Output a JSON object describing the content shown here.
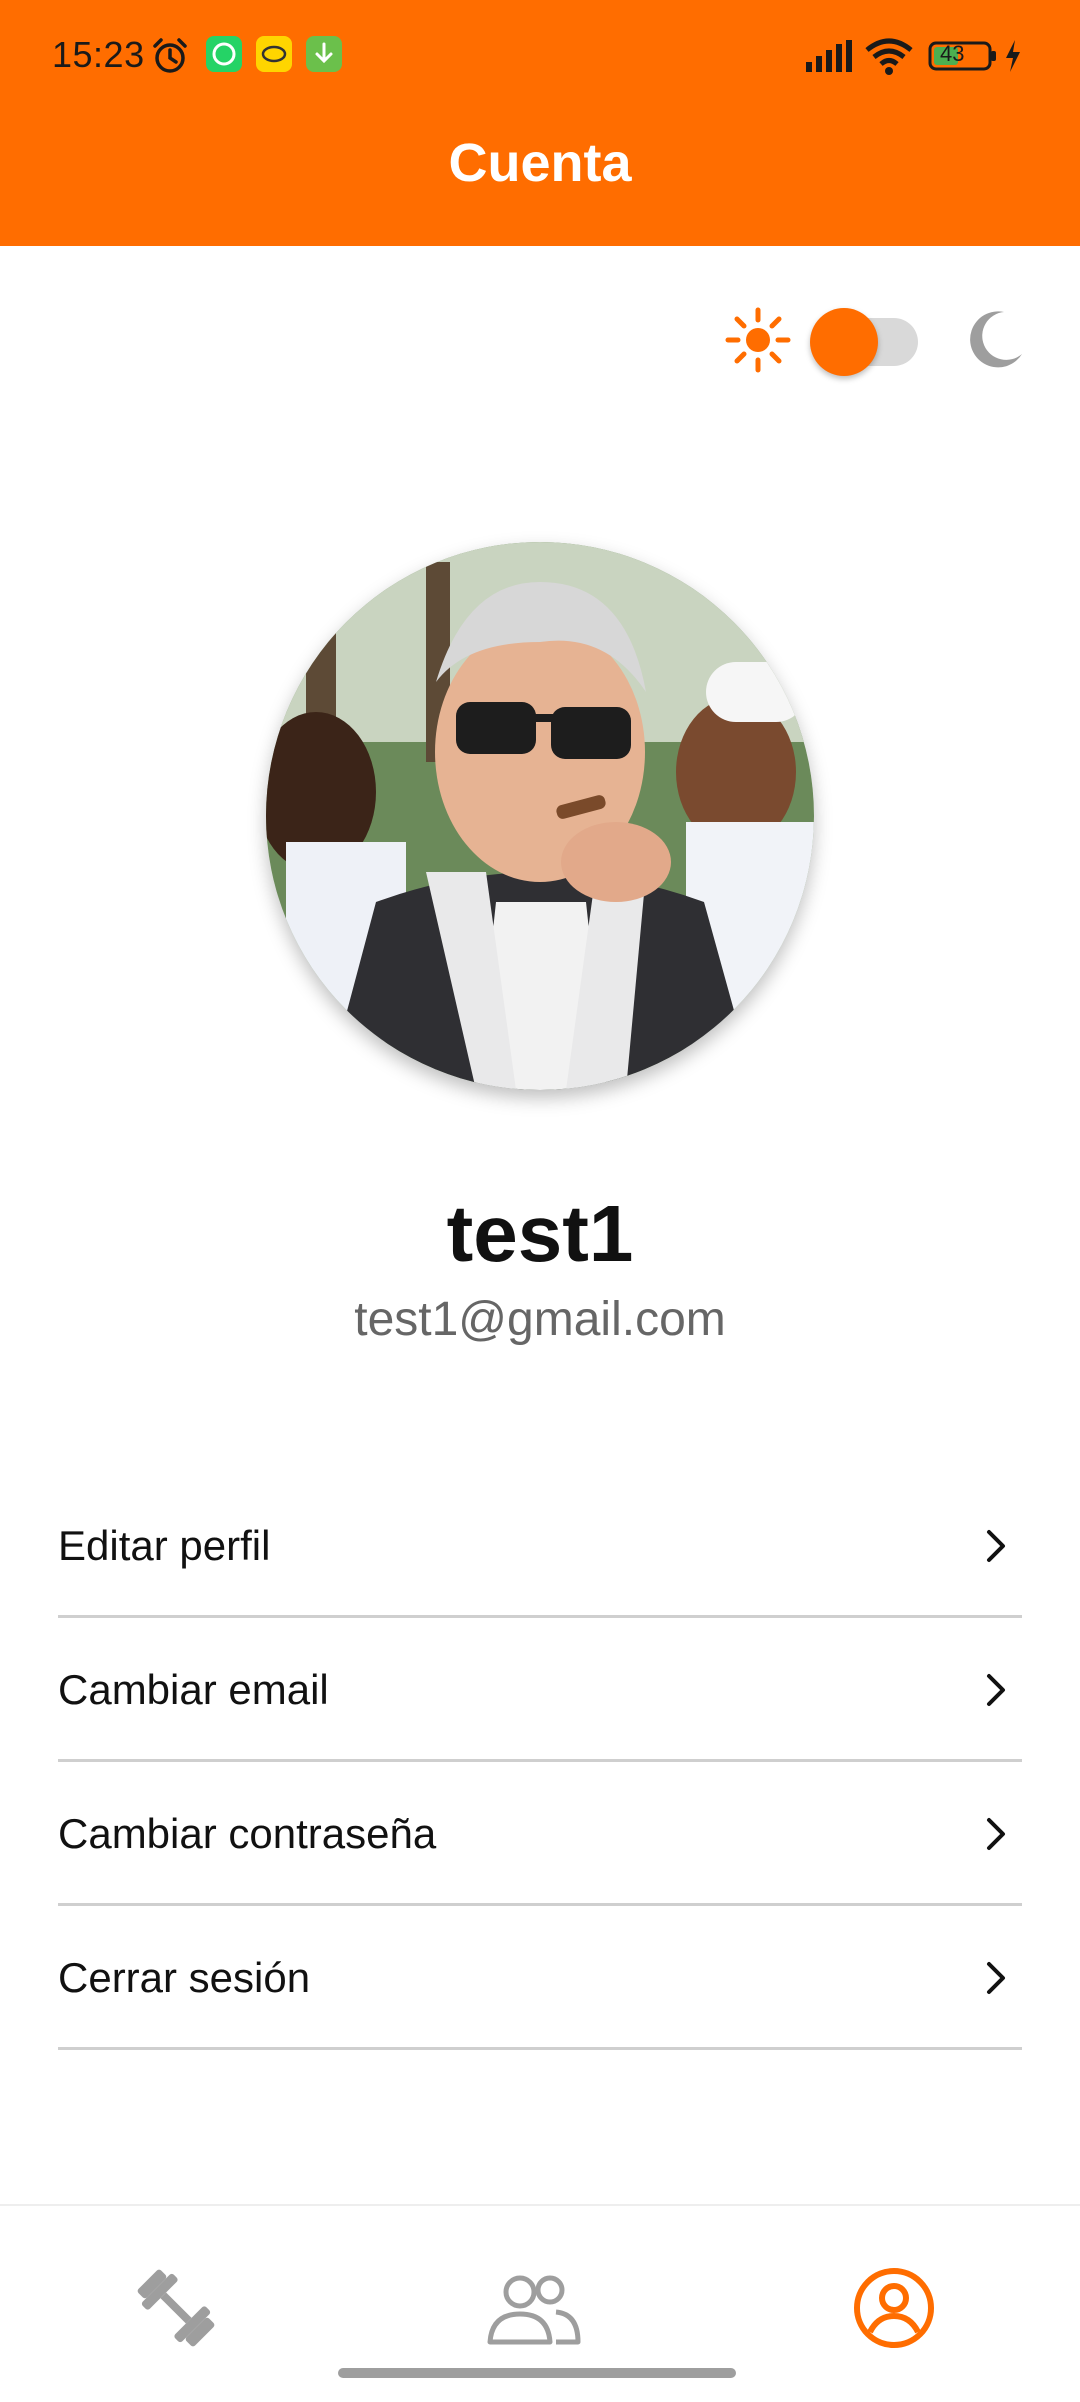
{
  "status_bar": {
    "time": "15:23",
    "battery": "43"
  },
  "header": {
    "title": "Cuenta"
  },
  "theme_toggle": {
    "mode": "light",
    "accent": "#FF6D00"
  },
  "profile": {
    "username": "test1",
    "email": "test1@gmail.com"
  },
  "menu": {
    "items": [
      {
        "label": "Editar perfil"
      },
      {
        "label": "Cambiar email"
      },
      {
        "label": "Cambiar contraseña"
      },
      {
        "label": "Cerrar sesión"
      }
    ]
  },
  "bottom_nav": {
    "items": [
      {
        "icon": "dumbbell-icon",
        "active": false
      },
      {
        "icon": "people-icon",
        "active": false
      },
      {
        "icon": "account-icon",
        "active": true
      }
    ]
  },
  "colors": {
    "primary": "#FF6D00",
    "text": "#111111",
    "secondary_text": "#666666",
    "divider": "#CFCFCF"
  }
}
